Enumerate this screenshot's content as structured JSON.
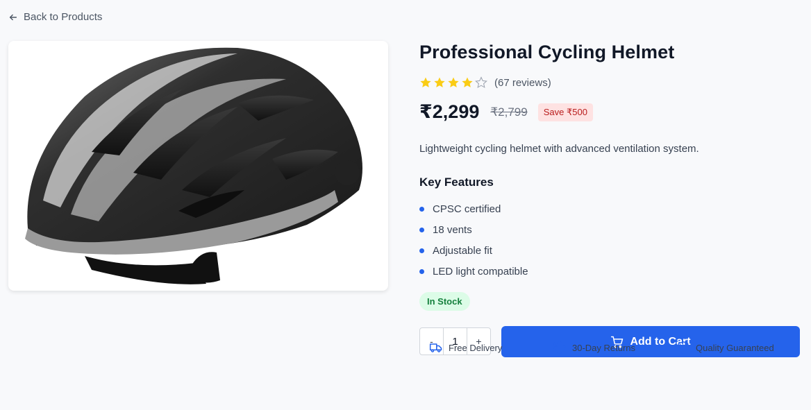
{
  "nav": {
    "back_label": "Back to Products",
    "back_icon": "arrow-left-icon"
  },
  "product": {
    "image_alt": "Professional Cycling Helmet",
    "title": "Professional Cycling Helmet",
    "rating": 4,
    "rating_max": 5,
    "reviews_label": "(67 reviews)",
    "price": "₹2,299",
    "original_price": "₹2,799",
    "save_label": "Save ₹500",
    "description": "Lightweight cycling helmet with advanced ventilation system.",
    "features_title": "Key Features",
    "features": [
      "CPSC certified",
      "18 vents",
      "Adjustable fit",
      "LED light compatible"
    ],
    "stock_label": "In Stock"
  },
  "purchase": {
    "decrement_label": "-",
    "quantity": "1",
    "increment_label": "+",
    "add_to_cart_label": "Add to Cart",
    "cart_icon": "cart-icon"
  },
  "perks": [
    {
      "label": "Free Delivery",
      "icon": "truck-icon"
    },
    {
      "label": "30-Day Returns",
      "icon": "rotate-icon"
    },
    {
      "label": "Quality Guaranteed",
      "icon": "shield-icon"
    }
  ],
  "colors": {
    "accent": "#2563eb",
    "star": "#facc15",
    "in_stock_bg": "#dcfce7",
    "in_stock_text": "#15803d",
    "save_bg": "#fee2e2",
    "save_text": "#b91c1c",
    "page_bg": "#f8f9fb"
  }
}
